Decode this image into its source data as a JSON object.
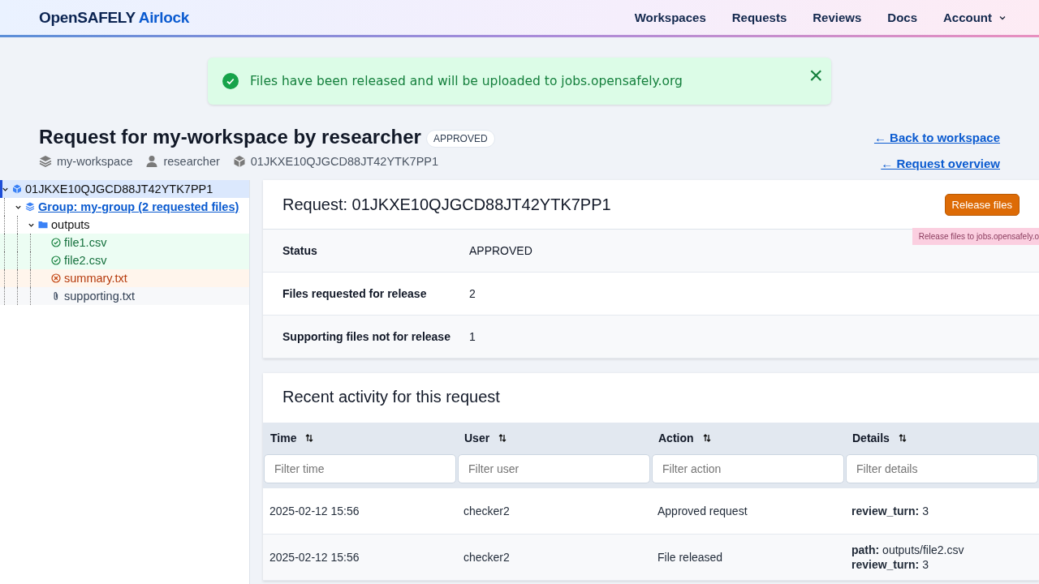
{
  "header": {
    "brand": "OpenSAFELY",
    "brand_accent": "Airlock",
    "nav": [
      {
        "label": "Workspaces"
      },
      {
        "label": "Requests"
      },
      {
        "label": "Reviews"
      },
      {
        "label": "Docs"
      },
      {
        "label": "Account",
        "dropdown": true
      }
    ]
  },
  "flash": {
    "message": "Files have been released and will be uploaded to jobs.opensafely.org",
    "dismiss": "×"
  },
  "page": {
    "title": "Request for my-workspace by researcher",
    "badge": "APPROVED",
    "meta": [
      {
        "kind": "workspace",
        "text": "my-workspace"
      },
      {
        "kind": "user",
        "text": "researcher"
      },
      {
        "kind": "request",
        "text": "01JKXE10QJGCD88JT42YTK7PP1"
      }
    ],
    "links": [
      "← Back to workspace",
      "← Request overview"
    ]
  },
  "tree": [
    {
      "kind": "request",
      "label": "01JKXE10QJGCD88JT42YTK7PP1",
      "selected": true,
      "expanded": true,
      "children": [
        {
          "kind": "group",
          "label": "Group: my-group (2 requested files)",
          "selected": false,
          "expanded": true,
          "children": [
            {
              "kind": "folder",
              "label": "outputs",
              "selected": false,
              "expanded": true,
              "children": [
                {
                  "kind": "approved",
                  "label": "file1.csv",
                  "selected": false
                },
                {
                  "kind": "approved",
                  "label": "file2.csv",
                  "selected": false
                },
                {
                  "kind": "rejected",
                  "label": "summary.txt",
                  "selected": false
                },
                {
                  "kind": "supporting",
                  "label": "supporting.txt",
                  "selected": false
                }
              ]
            }
          ]
        }
      ]
    }
  ],
  "request_card": {
    "title": "Request: 01JKXE10QJGCD88JT42YTK7PP1",
    "button": "Release files",
    "tooltip": "Release files to jobs.opensafely.o",
    "rows": [
      {
        "label": "Status",
        "value": "APPROVED"
      },
      {
        "label": "Files requested for release",
        "value": "2"
      },
      {
        "label": "Supporting files not for release",
        "value": "1"
      }
    ]
  },
  "activity": {
    "title": "Recent activity for this request",
    "columns": [
      {
        "label": "Time",
        "placeholder": "Filter time"
      },
      {
        "label": "User",
        "placeholder": "Filter user"
      },
      {
        "label": "Action",
        "placeholder": "Filter action"
      },
      {
        "label": "Details",
        "placeholder": "Filter details"
      }
    ],
    "rows": [
      [
        "2025-02-12 15:56",
        "checker2",
        "Approved request",
        [
          "**review_turn:** 3"
        ]
      ],
      [
        "2025-02-12 15:56",
        "checker2",
        "File released",
        [
          "**path:** outputs/file2.csv",
          "**review_turn:** 3"
        ]
      ]
    ]
  }
}
